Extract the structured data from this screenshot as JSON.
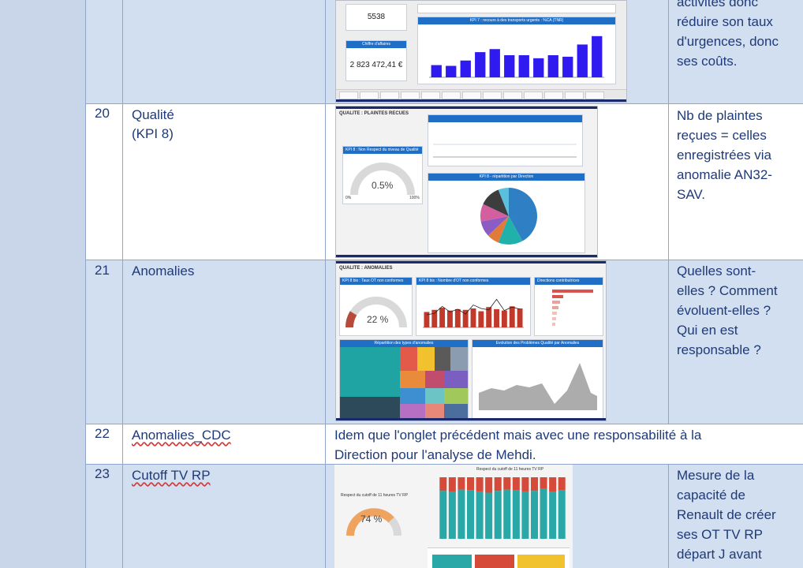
{
  "rows": [
    {
      "num": "",
      "name": "",
      "desc": "activités donc\nréduire son taux\nd'urgences, donc\nses coûts."
    },
    {
      "num": "20",
      "name": "Qualité\n(KPI 8)",
      "desc": "Nb de plaintes\nreçues = celles\nenregistrées via\nanomalie AN32-\nSAV."
    },
    {
      "num": "21",
      "name": "Anomalies",
      "desc": "Quelles sont-\nelles ? Comment\névoluent-elles ?\nQui en est\nresponsable ?"
    },
    {
      "num": "22",
      "name": "Anomalies_CDC",
      "desc": "Idem que l'onglet précédent mais avec une responsabilité à la\nDirection pour l'analyse de Mehdi."
    },
    {
      "num": "23",
      "name": "Cutoff TV RP",
      "desc": "Mesure de la\ncapacité de\nRenault de créer\nses OT TV RP\ndépart J avant"
    }
  ],
  "thumb19": {
    "kpi1_value": "5538",
    "kpi2_label": "Chiffre d'affaires",
    "kpi2_value": "2 823 472,41 €",
    "chart_title": "KPI 7 : recours à des transports urgents : %CA (TNR)",
    "chart_data": {
      "type": "bar",
      "values": [
        16,
        15,
        22,
        33,
        37,
        29,
        29,
        25,
        29,
        27,
        43,
        54
      ],
      "ylim": [
        0,
        60
      ],
      "color": "#2f1bef"
    }
  },
  "thumb20": {
    "title": "QUALITE : PLAINTES RECUES",
    "gauge_title": "KPI 8 : Non Respect du niveau de Qualité",
    "gauge_value": "0.5%",
    "gauge_min": "0%",
    "gauge_max": "100%",
    "pie_title": "KPI 8 - répartition par Direction",
    "chart_data": {
      "type": "pie",
      "values": [
        42,
        14,
        7,
        9,
        10,
        12,
        6
      ],
      "colors": [
        "#2e7fc4",
        "#20b2aa",
        "#e07b39",
        "#8b5cc4",
        "#d35fa1",
        "#3d3d3d",
        "#5bc0de"
      ]
    }
  },
  "thumb21": {
    "title": "QUALITE : ANOMALIES",
    "gauge_title": "KPI 8 bis : Taux OT non conformes",
    "gauge_value": "22 %",
    "bar_title": "KPI 8 bis : Nombre d'OT non conformes",
    "top_title": "Directions contributrices",
    "treemap_title": "Répartition des types d'anomalies",
    "area_title": "Evolution des Problèmes Qualité par Anomalies",
    "chart_data": {
      "type": "bar",
      "values": [
        22,
        25,
        28,
        24,
        26,
        25,
        27,
        23,
        29,
        26,
        24,
        30,
        27
      ],
      "line": [
        18,
        20,
        30,
        22,
        26,
        19,
        32,
        27,
        25,
        40,
        24,
        29,
        26
      ],
      "color": "#c0392b"
    }
  },
  "thumb23": {
    "gauge_label": "Respect du cutoff de 11 heures TV RP",
    "gauge_value": "74 %",
    "chart_title": "Respect du cutoff de 11 heures TV RP",
    "chart_data": {
      "type": "bar",
      "series": [
        {
          "name": "",
          "values": [
            78,
            76,
            80,
            79,
            77,
            75,
            78,
            80,
            79,
            77,
            78,
            81,
            76,
            79
          ]
        },
        {
          "name": "",
          "values": [
            22,
            24,
            20,
            21,
            23,
            25,
            22,
            20,
            21,
            23,
            22,
            19,
            24,
            21
          ]
        }
      ],
      "colors": [
        "#2aa8a8",
        "#d64a3a"
      ]
    }
  }
}
